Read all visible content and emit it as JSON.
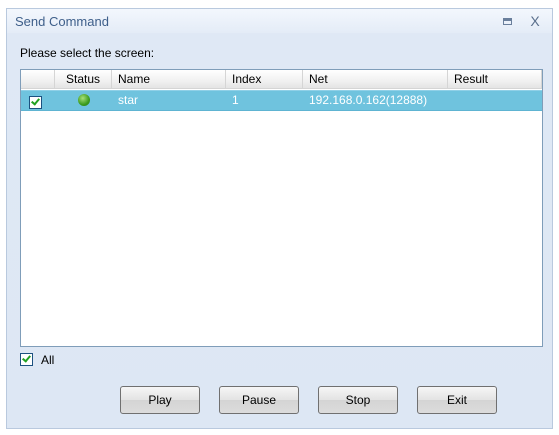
{
  "window": {
    "title": "Send Command",
    "maximize_glyph": "maximize-icon",
    "close_label": "X"
  },
  "prompt": "Please select the screen:",
  "table": {
    "columns": [
      "",
      "Status",
      "Name",
      "Index",
      "Net",
      "Result"
    ],
    "rows": [
      {
        "checked": true,
        "status": "online",
        "name": "star",
        "index": "1",
        "net": "192.168.0.162(12888)",
        "result": ""
      }
    ],
    "selected_row_color": "#6fc3de"
  },
  "all_checkbox": {
    "label": "All",
    "checked": true
  },
  "buttons": {
    "play": "Play",
    "pause": "Pause",
    "stop": "Stop",
    "exit": "Exit"
  },
  "colors": {
    "title_text": "#3e5f8a",
    "status_online": "#3c9b1e",
    "check_tick": "#21a121"
  }
}
